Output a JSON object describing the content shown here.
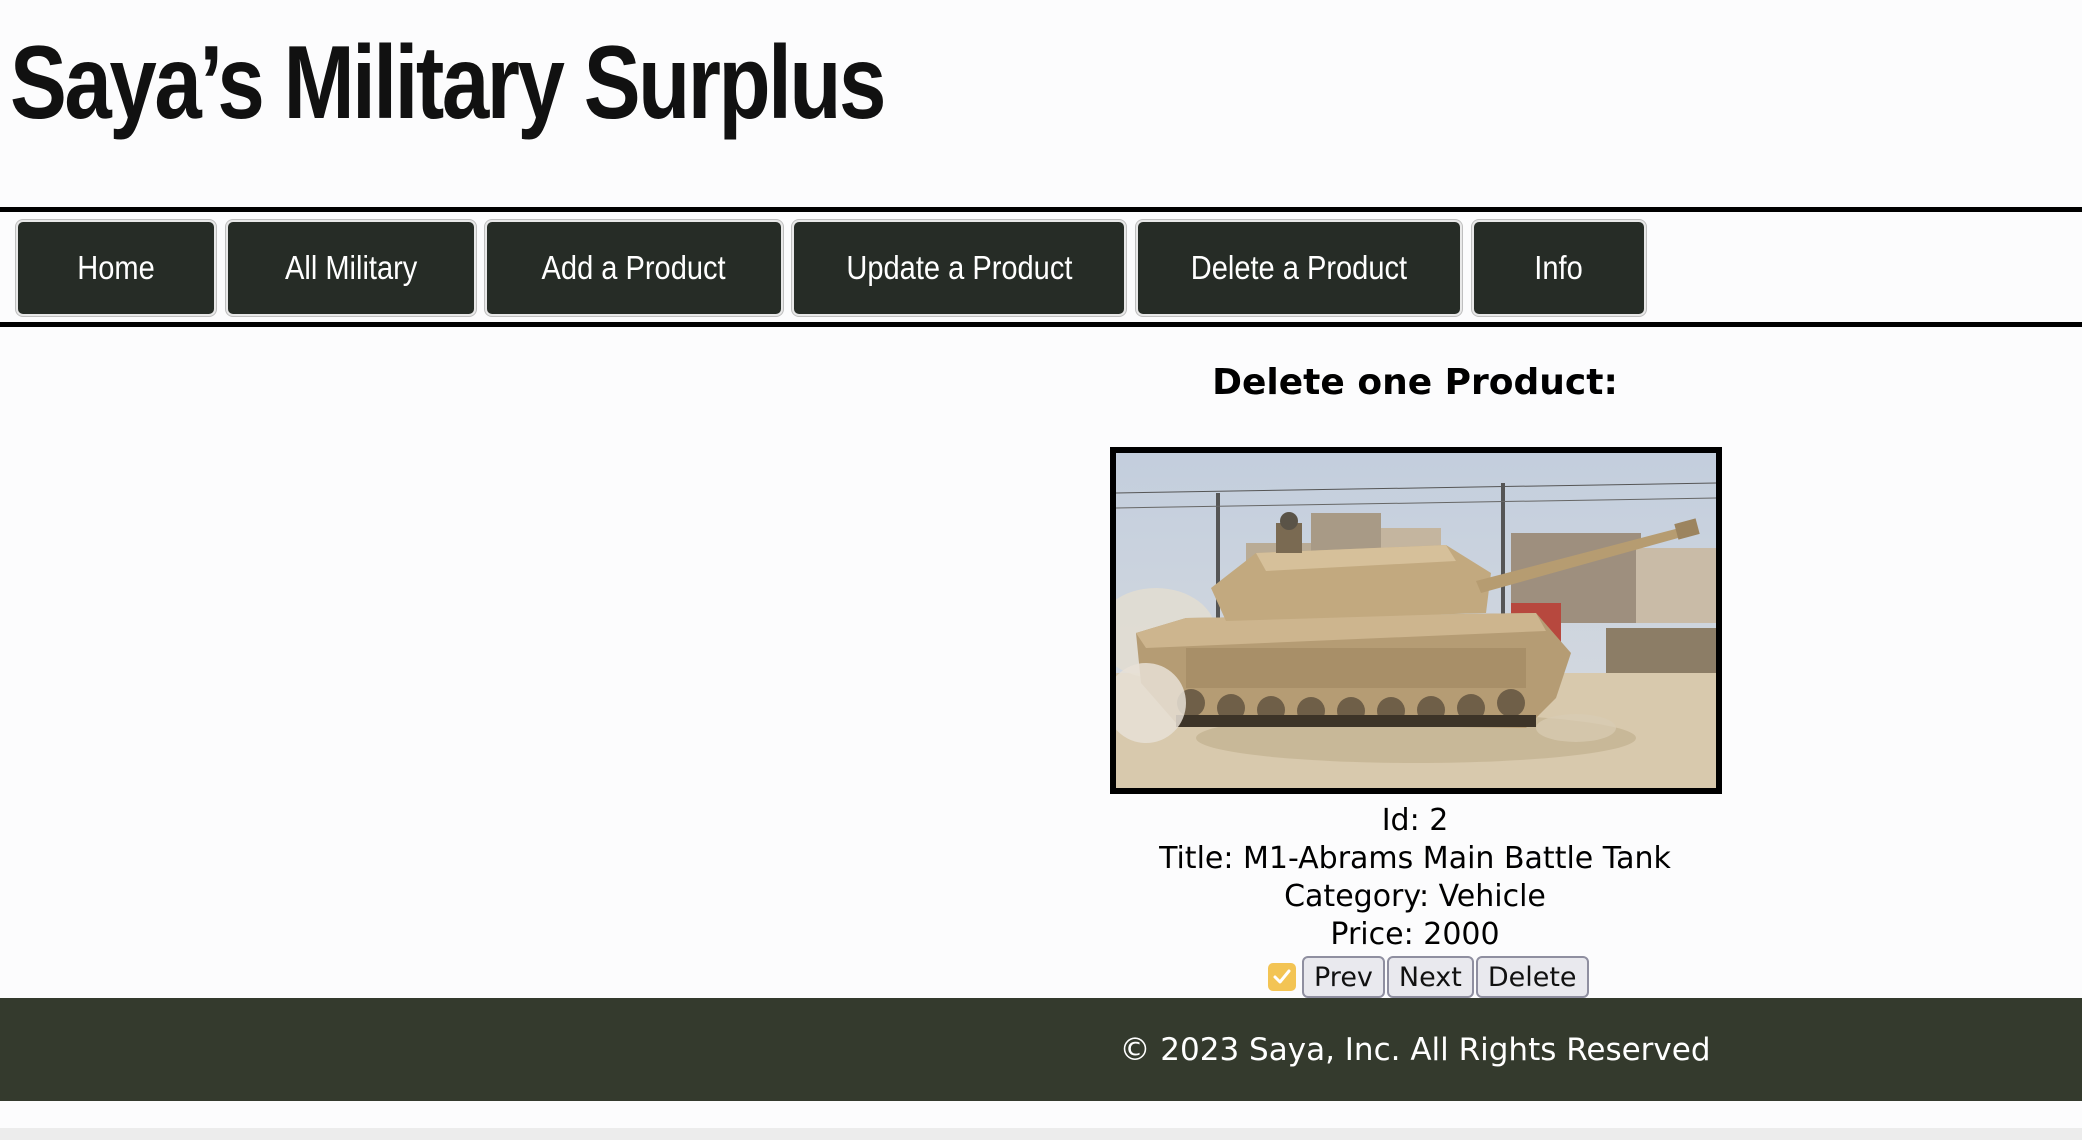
{
  "site": {
    "title": "Saya’s Military Surplus"
  },
  "nav": {
    "items": [
      {
        "label": "Home"
      },
      {
        "label": "All Military"
      },
      {
        "label": "Add a Product"
      },
      {
        "label": "Update a Product"
      },
      {
        "label": "Delete a Product"
      },
      {
        "label": "Info"
      }
    ]
  },
  "main": {
    "heading": "Delete one Product:",
    "product": {
      "id_line": "Id: 2",
      "title_line": "Title: M1-Abrams Main Battle Tank",
      "category_line": "Category: Vehicle",
      "price_line": "Price: 2000"
    },
    "controls": {
      "checkbox_checked": true,
      "prev_label": "Prev",
      "next_label": "Next",
      "delete_label": "Delete"
    }
  },
  "footer": {
    "text": "© 2023 Saya, Inc. All Rights Reserved"
  },
  "colors": {
    "nav_button": "#262c26",
    "footer": "#343a2d",
    "checkbox": "#f3c454"
  }
}
